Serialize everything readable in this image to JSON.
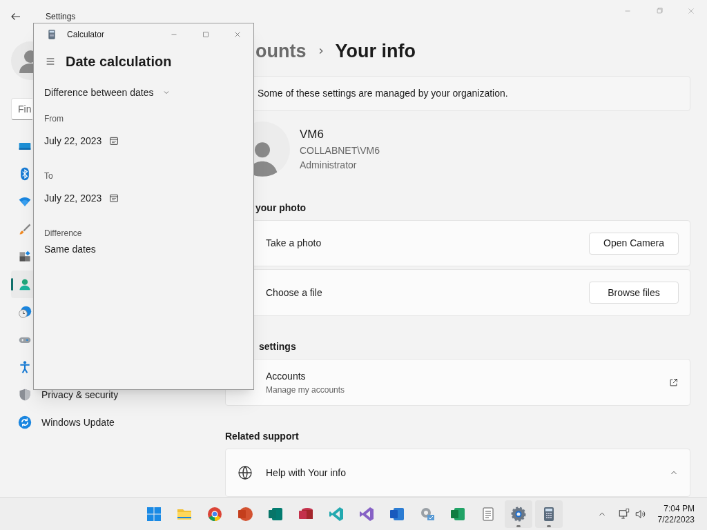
{
  "settings": {
    "title": "Settings",
    "search": {
      "placeholder": "Fin"
    },
    "sidebar": [
      {
        "kind": "system",
        "selected": false
      },
      {
        "kind": "bluetooth",
        "selected": false
      },
      {
        "kind": "network",
        "selected": false
      },
      {
        "kind": "personalization",
        "selected": false
      },
      {
        "kind": "apps",
        "selected": false
      },
      {
        "kind": "accounts",
        "selected": true
      },
      {
        "kind": "time",
        "selected": false
      },
      {
        "kind": "gaming",
        "selected": false
      },
      {
        "kind": "accessibility",
        "selected": false
      },
      {
        "kind": "privacy",
        "selected": false,
        "label": "Privacy & security"
      },
      {
        "kind": "update",
        "selected": false,
        "label": "Windows Update"
      }
    ],
    "breadcrumb": "ounts",
    "page_title": "Your info",
    "notice": "Some of these settings are managed by your organization.",
    "user": {
      "name": "VM6",
      "account": "COLLABNET\\VM6",
      "role": "Administrator"
    },
    "photo_heading": "your photo",
    "photo_rows": [
      {
        "label": "Take a photo",
        "button": "Open Camera"
      },
      {
        "label": "Choose a file",
        "button": "Browse files"
      }
    ],
    "related_heading": "settings",
    "accounts_row": {
      "title": "Accounts",
      "subtitle": "Manage my accounts"
    },
    "support_heading": "Related support",
    "help_row": {
      "label": "Help with Your info",
      "expanded": true
    }
  },
  "calculator": {
    "title": "Calculator",
    "header": "Date calculation",
    "mode": "Difference between dates",
    "from_label": "From",
    "from_value": "July 22, 2023",
    "to_label": "To",
    "to_value": "July 22, 2023",
    "difference_label": "Difference",
    "difference_value": "Same dates"
  },
  "taskbar": {
    "apps": [
      {
        "kind": "start",
        "running": false
      },
      {
        "kind": "folder",
        "running": false
      },
      {
        "kind": "browser",
        "running": false
      },
      {
        "kind": "slides",
        "running": false
      },
      {
        "kind": "publisher",
        "running": false
      },
      {
        "kind": "database",
        "running": false
      },
      {
        "kind": "code",
        "running": false
      },
      {
        "kind": "ide",
        "running": false
      },
      {
        "kind": "document",
        "running": false
      },
      {
        "kind": "control",
        "running": false
      },
      {
        "kind": "sheet",
        "running": false
      },
      {
        "kind": "notes",
        "running": false
      },
      {
        "kind": "settings",
        "running": true
      },
      {
        "kind": "calculator",
        "running": true
      }
    ],
    "time": "7:04 PM",
    "date": "7/22/2023"
  }
}
